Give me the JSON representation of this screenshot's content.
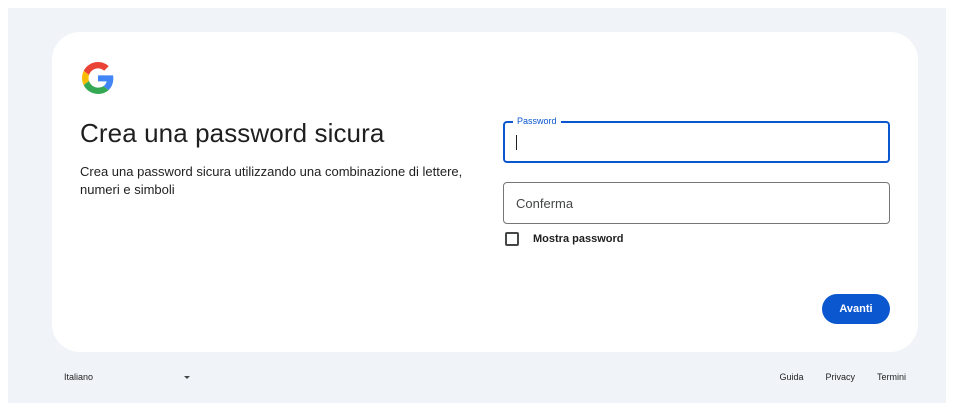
{
  "brand": {
    "logo_icon": "google-g-icon",
    "colors": {
      "blue": "#4285F4",
      "red": "#EA4335",
      "yellow": "#FBBC05",
      "green": "#34A853",
      "accent": "#0b57d0"
    }
  },
  "heading": {
    "title": "Crea una password sicura",
    "subtitle": "Crea una password sicura utilizzando una combinazione di lettere, numeri e simboli"
  },
  "form": {
    "password": {
      "label": "Password",
      "value": ""
    },
    "confirm": {
      "placeholder": "Conferma",
      "value": ""
    },
    "show_password": {
      "label": "Mostra password",
      "checked": false
    },
    "next_label": "Avanti"
  },
  "footer": {
    "language": "Italiano",
    "links": {
      "help": "Guida",
      "privacy": "Privacy",
      "terms": "Termini"
    }
  }
}
